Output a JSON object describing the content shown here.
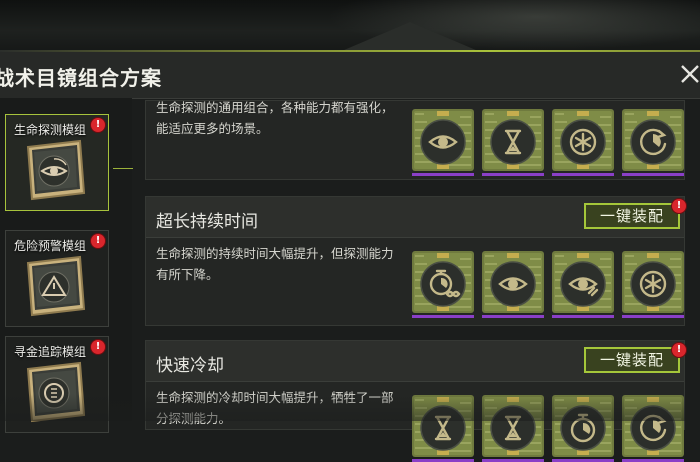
{
  "window": {
    "title": "战术目镜组合方案",
    "close_icon": "close-x-icon"
  },
  "colors": {
    "accent_green": "#a5c73a",
    "badge_red": "#d9262c",
    "rarity_purple": "#8a3fc7",
    "panel_dark": "#242624"
  },
  "sidebar": {
    "modules": [
      {
        "label": "生命探测模组",
        "icon": "eye-scan-chip-icon",
        "badge": "!",
        "selected": true
      },
      {
        "label": "危险预警模组",
        "icon": "warning-chip-icon",
        "badge": "!",
        "selected": false
      },
      {
        "label": "寻金追踪模组",
        "icon": "gold-tracking-chip-icon",
        "badge": "!",
        "selected": false
      }
    ]
  },
  "plans": [
    {
      "title": "",
      "description": "生命探测的通用组合，各种能力都有强化，能适应更多的场景。",
      "equip_label": "",
      "icons": [
        "eye-scan-icon",
        "hourglass-icon",
        "snowflake-icon",
        "cooldown-clock-icon"
      ]
    },
    {
      "title": "超长持续时间",
      "description": "生命探测的持续时间大幅提升，但探测能力有所下降。",
      "equip_label": "一键装配",
      "badge": "!",
      "icons": [
        "stopwatch-infinity-icon",
        "eye-scan-icon",
        "eye-scan-plus-icon",
        "snowflake-icon"
      ]
    },
    {
      "title": "快速冷却",
      "description": "生命探测的冷却时间大幅提升，牺牲了一部分探测能力。",
      "equip_label": "一键装配",
      "badge": "!",
      "icons": [
        "hourglass-icon",
        "hourglass-icon",
        "stopwatch-icon",
        "cooldown-clock-icon"
      ]
    }
  ]
}
